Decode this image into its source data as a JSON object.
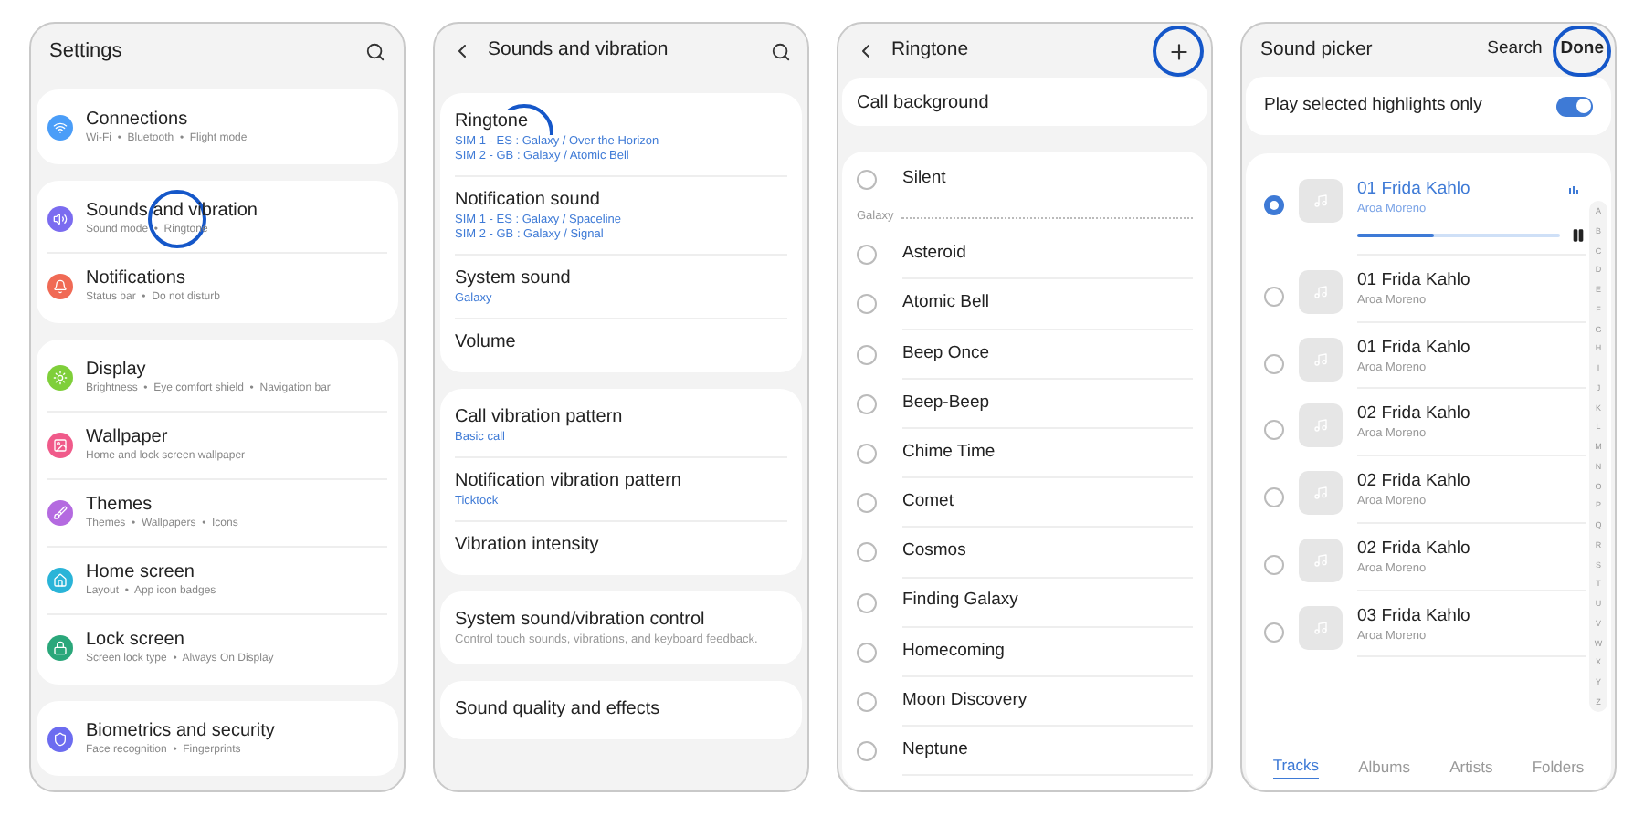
{
  "settings": {
    "title": "Settings",
    "groups": [
      [
        {
          "title": "Connections",
          "subtitle": "Wi-Fi  •  Bluetooth  •  Flight mode",
          "color": "#4a9df8",
          "highlighted": false
        }
      ],
      [
        {
          "title": "Sounds and vibration",
          "subtitle": "Sound mode  •  Ringtone",
          "color": "#7b6cf0",
          "highlighted": true
        },
        {
          "title": "Notifications",
          "subtitle": "Status bar  •  Do not disturb",
          "color": "#f06a55",
          "highlighted": false
        }
      ],
      [
        {
          "title": "Display",
          "subtitle": "Brightness  •  Eye comfort shield  •  Navigation bar",
          "color": "#7fcf3a",
          "highlighted": false
        },
        {
          "title": "Wallpaper",
          "subtitle": "Home and lock screen wallpaper",
          "color": "#f05a8a",
          "highlighted": false
        },
        {
          "title": "Themes",
          "subtitle": "Themes  •  Wallpapers  •  Icons",
          "color": "#b46ae0",
          "highlighted": false
        },
        {
          "title": "Home screen",
          "subtitle": "Layout  •  App icon badges",
          "color": "#2ab4d8",
          "highlighted": false
        },
        {
          "title": "Lock screen",
          "subtitle": "Screen lock type  •  Always On Display",
          "color": "#2aa77a",
          "highlighted": false
        }
      ],
      [
        {
          "title": "Biometrics and security",
          "subtitle": "Face recognition  •  Fingerprints",
          "color": "#6c6cf0",
          "highlighted": false
        }
      ]
    ]
  },
  "sounds": {
    "title": "Sounds and vibration",
    "groups": [
      [
        {
          "title": "Ringtone",
          "values": [
            "SIM 1 - ES : Galaxy / Over the Horizon",
            "SIM 2 - GB : Galaxy / Atomic Bell"
          ],
          "highlighted": true
        },
        {
          "title": "Notification sound",
          "values": [
            "SIM 1 - ES : Galaxy / Spaceline",
            "SIM 2 - GB : Galaxy / Signal"
          ],
          "highlighted": false
        },
        {
          "title": "System sound",
          "values": [
            "Galaxy"
          ],
          "highlighted": false
        },
        {
          "title": "Volume",
          "highlighted": false
        }
      ],
      [
        {
          "title": "Call vibration pattern",
          "values": [
            "Basic call"
          ],
          "highlighted": false
        },
        {
          "title": "Notification vibration pattern",
          "values": [
            "Ticktock"
          ],
          "highlighted": false
        },
        {
          "title": "Vibration intensity",
          "highlighted": false
        }
      ],
      [
        {
          "title": "System sound/vibration control",
          "description": "Control touch sounds, vibrations, and keyboard feedback.",
          "highlighted": false
        }
      ],
      [
        {
          "title": "Sound quality and effects",
          "highlighted": false
        }
      ]
    ]
  },
  "ringtone": {
    "title": "Ringtone",
    "add_highlighted": true,
    "call_background": "Call background",
    "items": [
      {
        "kind": "option",
        "label": "Silent",
        "selected": false
      },
      {
        "kind": "section",
        "label": "Galaxy"
      },
      {
        "kind": "option",
        "label": "Asteroid",
        "selected": false
      },
      {
        "kind": "option",
        "label": "Atomic Bell",
        "selected": false
      },
      {
        "kind": "option",
        "label": "Beep Once",
        "selected": false
      },
      {
        "kind": "option",
        "label": "Beep-Beep",
        "selected": false
      },
      {
        "kind": "option",
        "label": "Chime Time",
        "selected": false
      },
      {
        "kind": "option",
        "label": "Comet",
        "selected": false
      },
      {
        "kind": "option",
        "label": "Cosmos",
        "selected": false
      },
      {
        "kind": "option",
        "label": "Finding Galaxy",
        "selected": false
      },
      {
        "kind": "option",
        "label": "Homecoming",
        "selected": false
      },
      {
        "kind": "option",
        "label": "Moon Discovery",
        "selected": false
      },
      {
        "kind": "option",
        "label": "Neptune",
        "selected": false
      }
    ]
  },
  "picker": {
    "title": "Sound picker",
    "search": "Search",
    "done": "Done",
    "done_highlighted": true,
    "highlights": {
      "label": "Play selected highlights only",
      "on": true
    },
    "tracks": [
      {
        "title": "01 Frida Kahlo",
        "artist": "Aroa Moreno",
        "selected": true,
        "level": 0.38
      },
      {
        "title": "01 Frida Kahlo",
        "artist": "Aroa Moreno",
        "selected": false
      },
      {
        "title": "01 Frida Kahlo",
        "artist": "Aroa Moreno",
        "selected": false
      },
      {
        "title": "02 Frida Kahlo",
        "artist": "Aroa Moreno",
        "selected": false
      },
      {
        "title": "02 Frida Kahlo",
        "artist": "Aroa Moreno",
        "selected": false
      },
      {
        "title": "02 Frida Kahlo",
        "artist": "Aroa Moreno",
        "selected": false
      },
      {
        "title": "03 Frida Kahlo",
        "artist": "Aroa Moreno",
        "selected": false
      }
    ],
    "index": [
      "A",
      "B",
      "C",
      "D",
      "E",
      "F",
      "G",
      "H",
      "I",
      "J",
      "K",
      "L",
      "M",
      "N",
      "O",
      "P",
      "Q",
      "R",
      "S",
      "T",
      "U",
      "V",
      "W",
      "X",
      "Y",
      "Z"
    ],
    "tabs": [
      {
        "label": "Tracks",
        "selected": true
      },
      {
        "label": "Albums",
        "selected": false
      },
      {
        "label": "Artists",
        "selected": false
      },
      {
        "label": "Folders",
        "selected": false
      }
    ]
  }
}
